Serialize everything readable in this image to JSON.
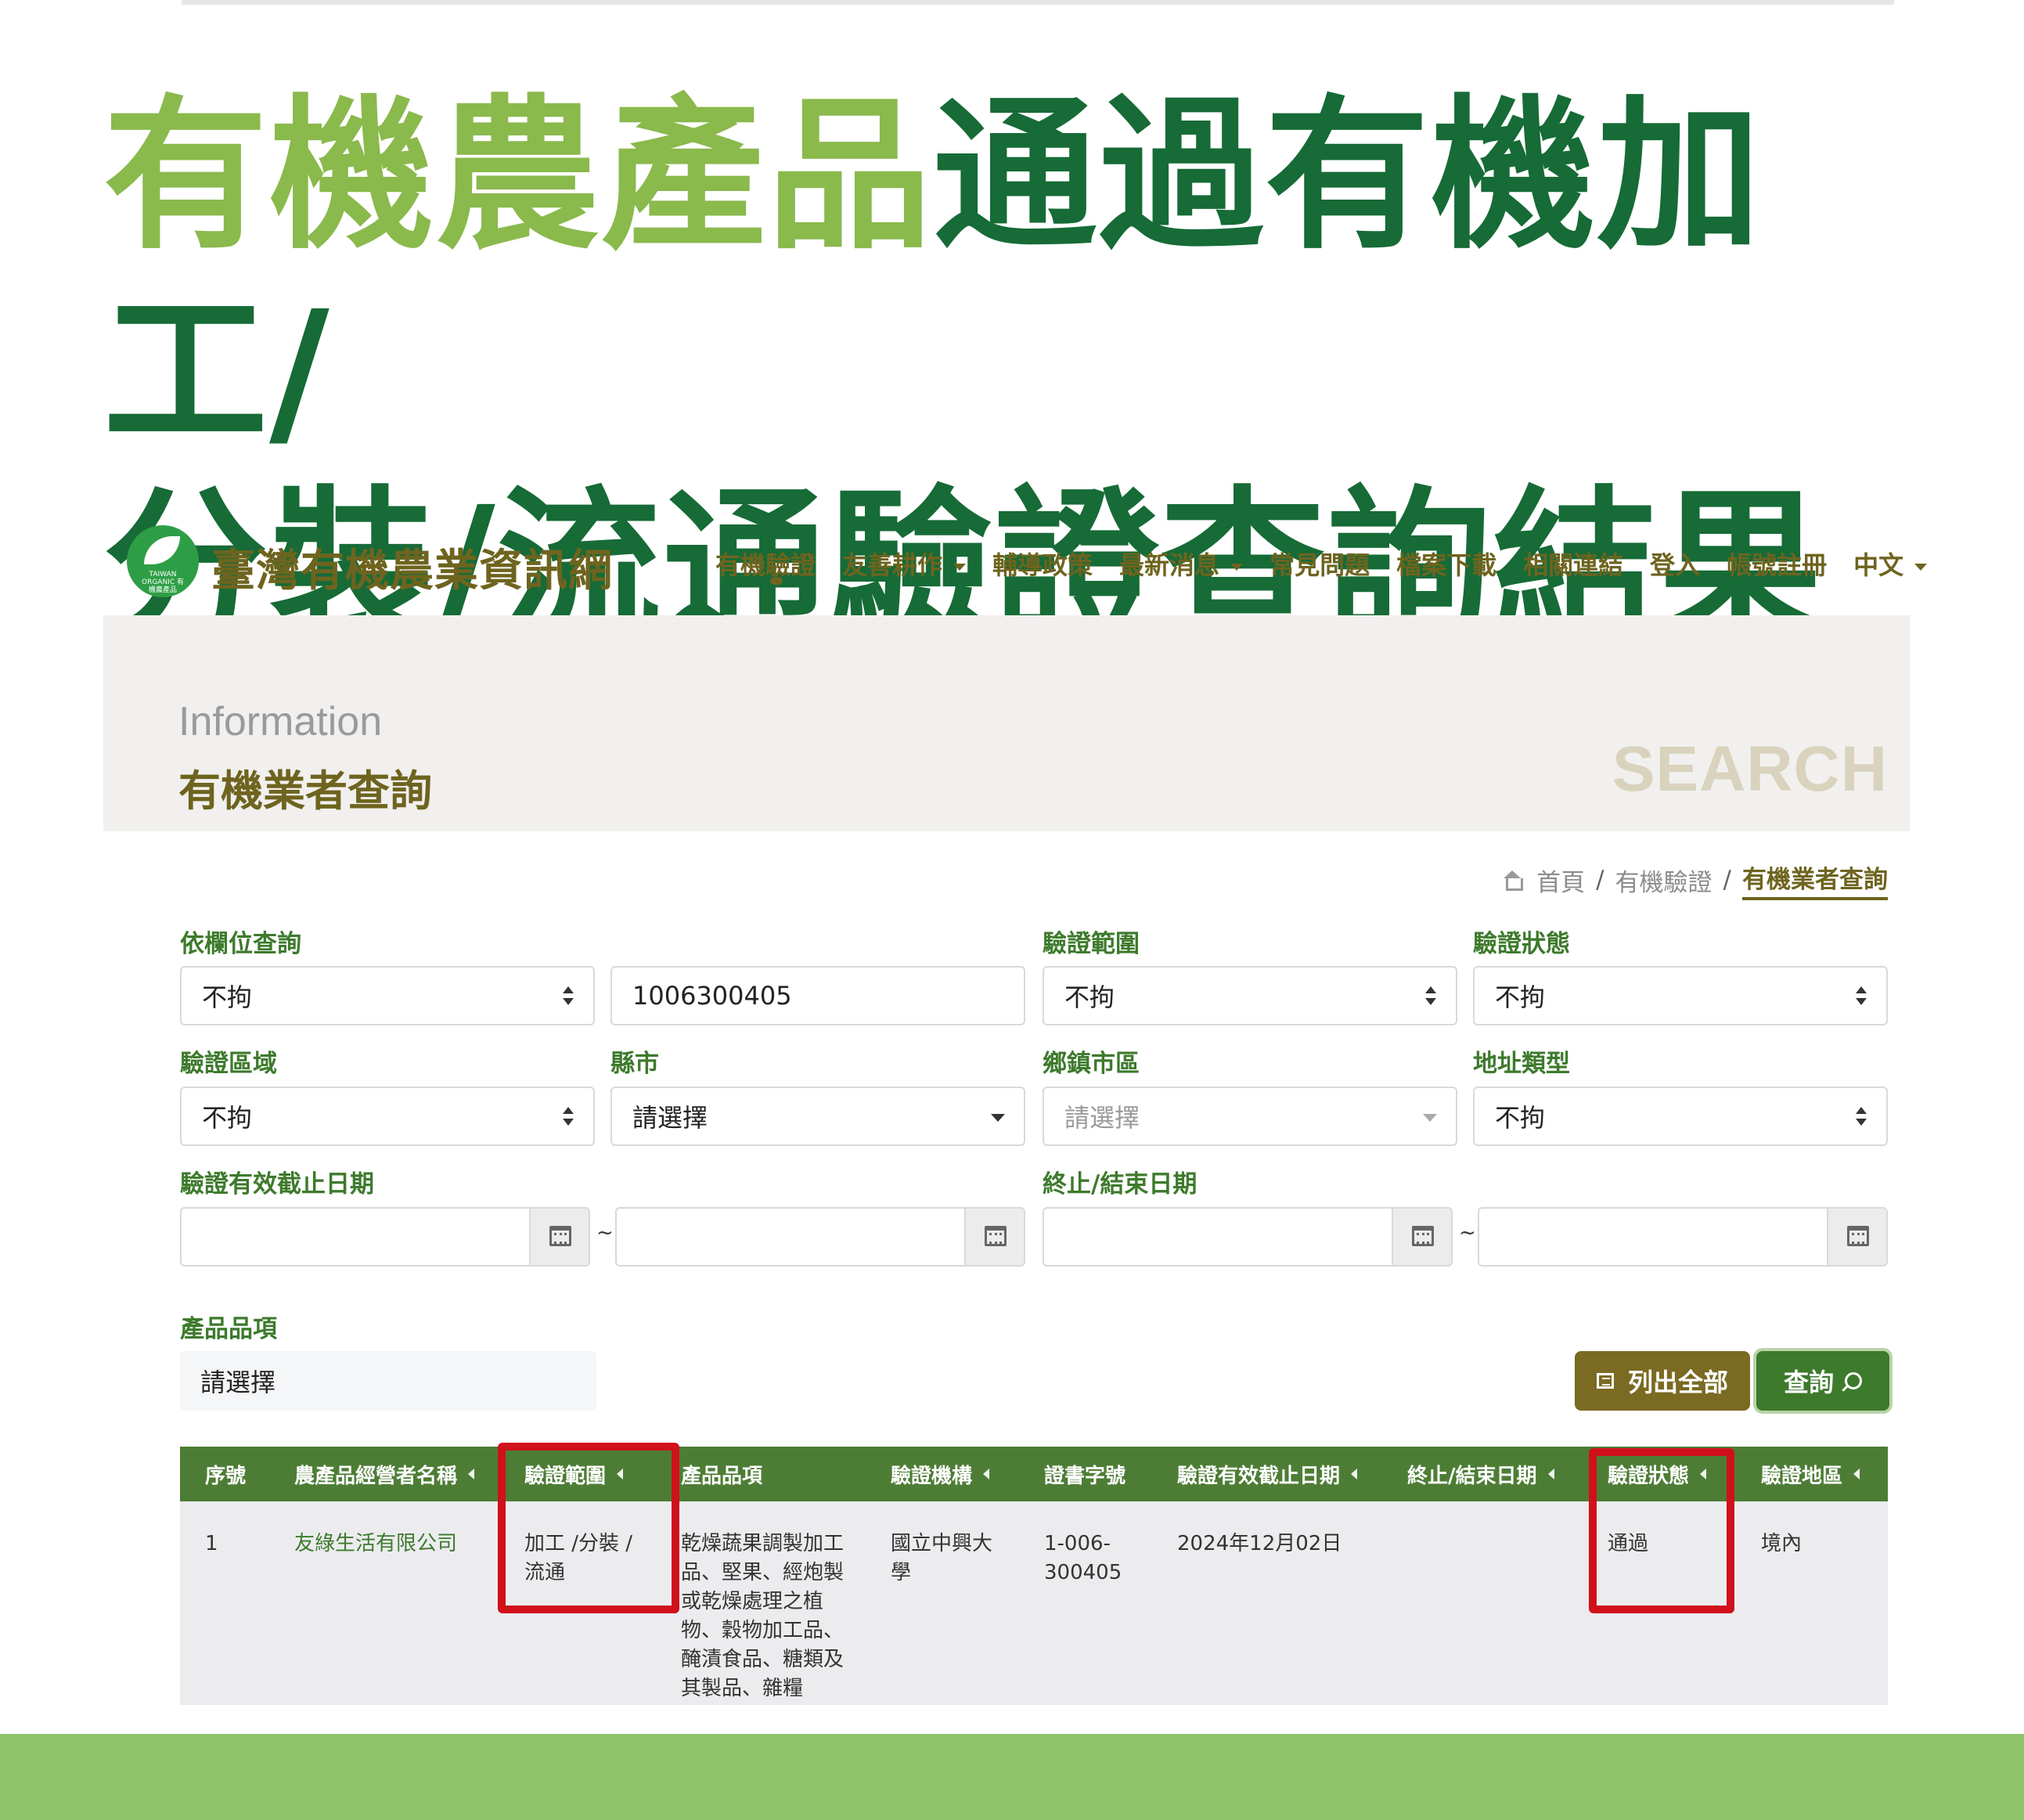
{
  "headline": {
    "part1": "有機農產品",
    "part2": "通過有機加工/",
    "part3": "分裝/流通驗證查詢結果"
  },
  "site": {
    "logo_text": "TAIWAN ORGANIC 有機農產品",
    "name": "臺灣有機農業資訊網"
  },
  "nav": {
    "items": [
      "有機驗證",
      "友善耕作",
      "輔導政策",
      "最新消息",
      "常見問題",
      "檔案下載",
      "相關連結",
      "登入",
      "帳號註冊",
      "中文"
    ]
  },
  "banner": {
    "subtitle": "Information",
    "title": "有機業者查詢",
    "watermark": "SEARCH"
  },
  "breadcrumb": {
    "home": "首頁",
    "level2": "有機驗證",
    "current": "有機業者查詢",
    "separator": "/"
  },
  "form": {
    "field_query_label": "依欄位查詢",
    "field_query_value": "不拘",
    "field_query_text": "1006300405",
    "scope_label": "驗證範圍",
    "scope_value": "不拘",
    "status_label": "驗證狀態",
    "status_value": "不拘",
    "region_label": "驗證區域",
    "region_value": "不拘",
    "county_label": "縣市",
    "county_value": "請選擇",
    "town_label": "鄉鎮市區",
    "town_value": "請選擇",
    "addr_type_label": "地址類型",
    "addr_type_value": "不拘",
    "valid_date_label": "驗證有效截止日期",
    "end_date_label": "終止/結束日期",
    "tilde": "~",
    "product_label": "產品品項",
    "product_value": "請選擇",
    "list_all_button": "列出全部",
    "query_button": "查詢"
  },
  "table": {
    "headers": [
      "序號",
      "農產品經營者名稱",
      "驗證範圍",
      "產品品項",
      "驗證機構",
      "證書字號",
      "驗證有效截止日期",
      "終止/結束日期",
      "驗證狀態",
      "驗證地區"
    ],
    "row": {
      "no": "1",
      "operator": "友綠生活有限公司",
      "scope_line1": "加工 /分裝 /",
      "scope_line2": "流通",
      "items_l1": "乾燥蔬果調製加工",
      "items_l2": "品、堅果、經炮製",
      "items_l3": "或乾燥處理之植",
      "items_l4": "物、穀物加工品、",
      "items_l5": "醃漬食品、糖類及",
      "items_l6": "其製品、雜糧",
      "agency_l1": "國立中興大",
      "agency_l2": "學",
      "cert_l1": "1-006-",
      "cert_l2": "300405",
      "valid_date": "2024年12月02日",
      "end_date": "",
      "status": "通過",
      "area": "境內"
    }
  },
  "colors": {
    "headline_light": "#8ab94c",
    "headline_dark": "#166b36",
    "brand_olive": "#6e641f",
    "table_header": "#4d7d35",
    "highlight_red": "#d0101b",
    "footer_green": "#90c46a"
  }
}
